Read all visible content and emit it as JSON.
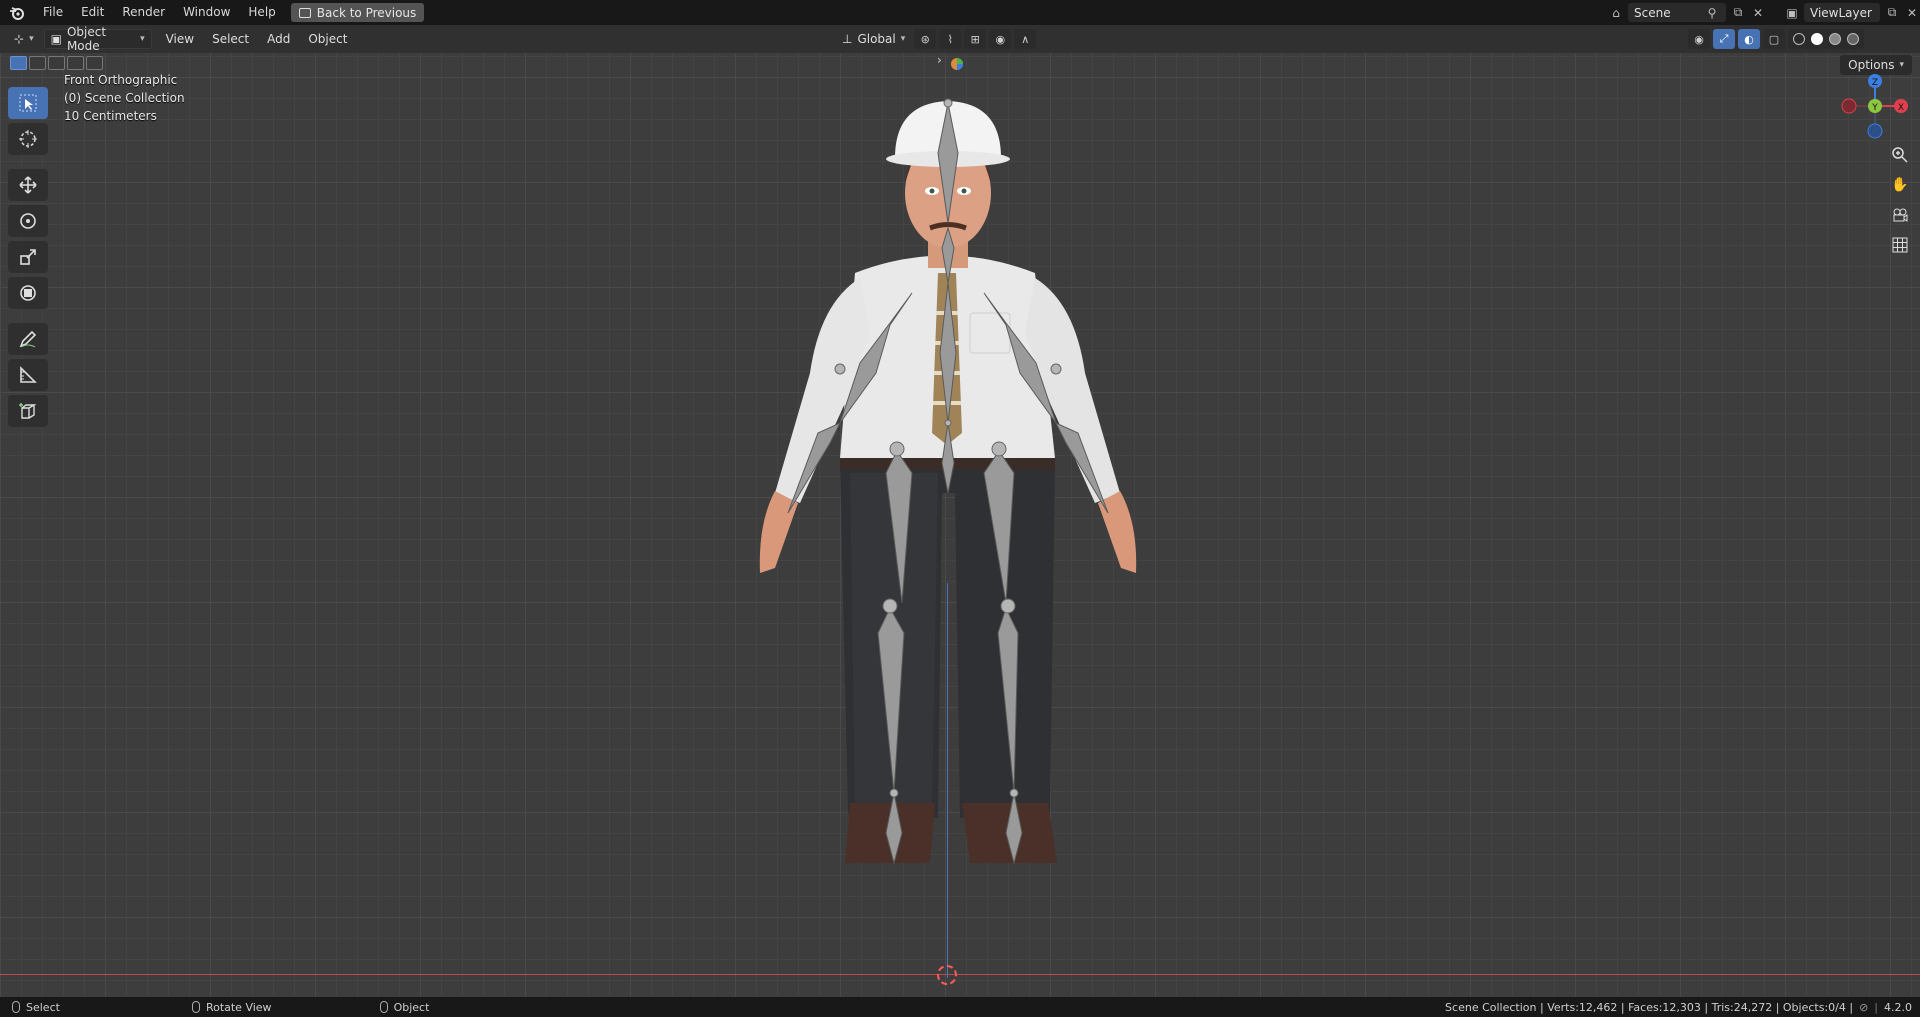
{
  "topbar": {
    "menu": [
      "File",
      "Edit",
      "Render",
      "Window",
      "Help"
    ],
    "back_button": "Back to Previous",
    "scene_name": "Scene",
    "view_layer_name": "ViewLayer",
    "icons": [
      "blender-logo-icon",
      "pin-icon",
      "copy-icon",
      "close-icon"
    ]
  },
  "header": {
    "mode": "Object Mode",
    "menus": [
      "View",
      "Select",
      "Add",
      "Object"
    ],
    "transform_orientation": "Global",
    "options_label": "Options"
  },
  "viewport": {
    "view_name": "Front Orthographic",
    "collection": "(0) Scene Collection",
    "scale": "10 Centimeters",
    "gizmo": {
      "z": "Z",
      "y": "Y",
      "x": "X"
    }
  },
  "statusbar": {
    "left": [
      {
        "label": "Select",
        "icon": "mouse-left-icon"
      },
      {
        "label": "Rotate View",
        "icon": "mouse-middle-icon"
      },
      {
        "label": "Object",
        "icon": "mouse-right-icon"
      }
    ],
    "stats": "Scene Collection | Verts:12,462 | Faces:12,303 | Tris:24,272 | Objects:0/4 |",
    "version": "4.2.0"
  },
  "colors": {
    "accent": "#4772b3",
    "axis_x": "#e0404e",
    "axis_y": "#8dc63f",
    "axis_z": "#3d7fe0"
  }
}
